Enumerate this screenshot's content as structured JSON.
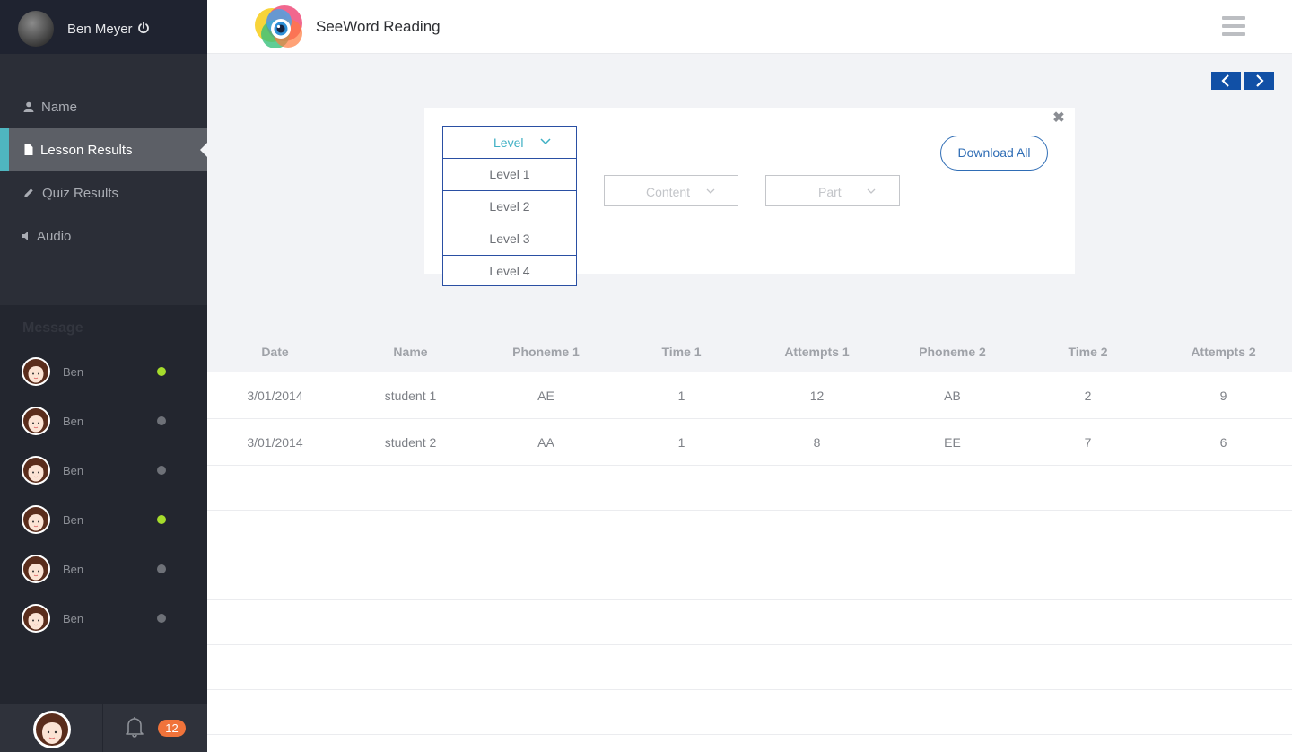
{
  "user": {
    "name": "Ben Meyer"
  },
  "menu": {
    "items": [
      {
        "label": "Name",
        "icon": "user-icon"
      },
      {
        "label": "Lesson Results",
        "icon": "document-icon",
        "active": true
      },
      {
        "label": "Quiz Results",
        "icon": "pencil-icon"
      },
      {
        "label": "Audio",
        "icon": "speaker-icon"
      }
    ]
  },
  "messages": {
    "title": "Message",
    "contacts": [
      {
        "name": "Ben",
        "online": true
      },
      {
        "name": "Ben",
        "online": false
      },
      {
        "name": "Ben",
        "online": false
      },
      {
        "name": "Ben",
        "online": true
      },
      {
        "name": "Ben",
        "online": false
      },
      {
        "name": "Ben",
        "online": false
      }
    ]
  },
  "footer": {
    "notification_count": "12"
  },
  "header": {
    "app_title": "SeeWord Reading"
  },
  "filters": {
    "level": {
      "label": "Level",
      "options": [
        "Level 1",
        "Level 2",
        "Level 3",
        "Level 4"
      ]
    },
    "content": {
      "label": "Content"
    },
    "part": {
      "label": "Part"
    },
    "download_label": "Download All",
    "close_symbol": "✖"
  },
  "table": {
    "columns": [
      "Date",
      "Name",
      "Phoneme 1",
      "Time 1",
      "Attempts 1",
      "Phoneme 2",
      "Time 2",
      "Attempts 2"
    ],
    "rows": [
      [
        "3/01/2014",
        "student 1",
        "AE",
        "1",
        "12",
        "AB",
        "2",
        "9"
      ],
      [
        "3/01/2014",
        "student 2",
        "AA",
        "1",
        "8",
        "EE",
        "7",
        "6"
      ]
    ]
  },
  "colors": {
    "accent": "#4fb6c0",
    "nav_blue": "#1150a6",
    "online": "#a6dc2c",
    "badge": "#f0733a"
  }
}
